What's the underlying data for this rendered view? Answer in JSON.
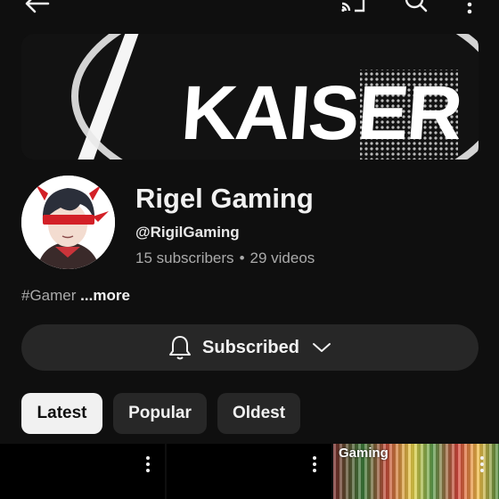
{
  "banner": {
    "text": "KAISER"
  },
  "channel": {
    "name": "Rigel Gaming",
    "handle": "@RigilGaming",
    "subscribers": "15 subscribers",
    "separator": "•",
    "videos": "29 videos",
    "description": "#Gamer",
    "more_label": "...more"
  },
  "subscribe_button": {
    "label": "Subscribed"
  },
  "chips": [
    {
      "label": "Latest",
      "selected": true
    },
    {
      "label": "Popular",
      "selected": false
    },
    {
      "label": "Oldest",
      "selected": false
    }
  ],
  "thumbnails": [
    {
      "title": ""
    },
    {
      "title": ""
    },
    {
      "title": "Gaming"
    }
  ],
  "icons": {
    "back": "back-arrow-icon",
    "cast": "cast-icon",
    "search": "search-icon",
    "menu": "more-vert-icon",
    "bell": "bell-icon",
    "chevron": "chevron-down-icon"
  },
  "colors": {
    "background": "#0f0f0f",
    "surface": "#272727",
    "text": "#f1f1f1",
    "secondary_text": "#aaaaaa",
    "selected_chip": "#f1f1f1",
    "accent_red": "#d32027"
  }
}
